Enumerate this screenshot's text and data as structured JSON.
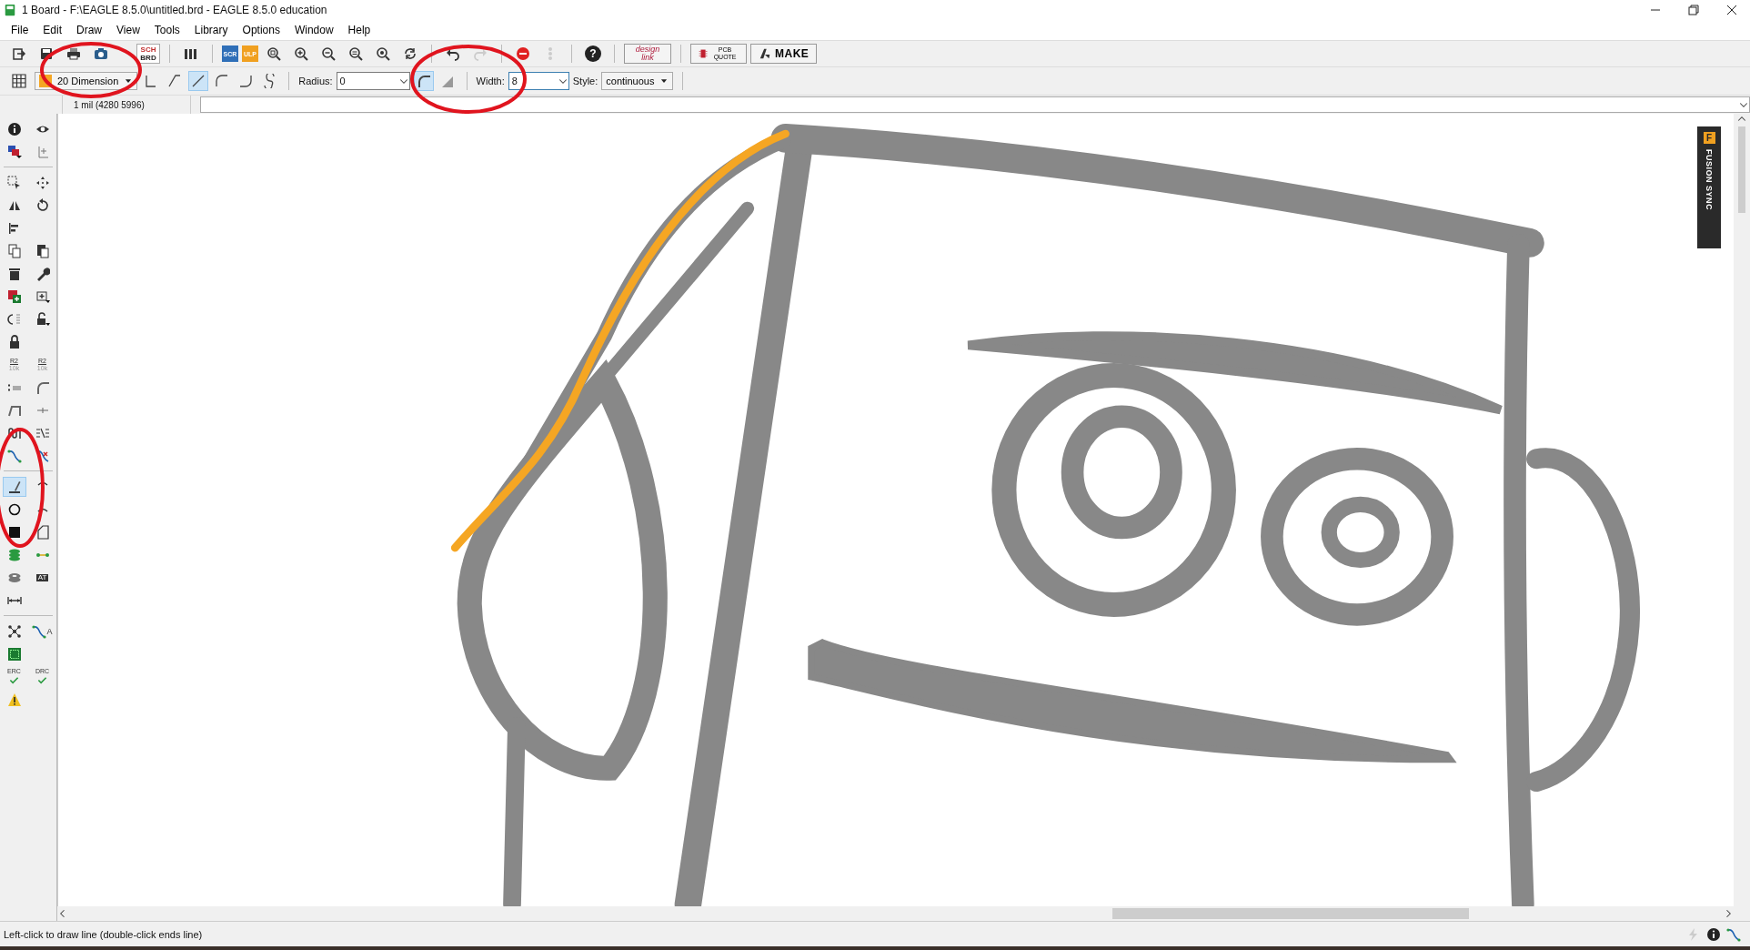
{
  "window": {
    "title": "1 Board - F:\\EAGLE 8.5.0\\untitled.brd - EAGLE 8.5.0 education"
  },
  "menu": [
    "File",
    "Edit",
    "Draw",
    "View",
    "Tools",
    "Library",
    "Options",
    "Window",
    "Help"
  ],
  "toolbar": {
    "switch_labels": [
      "SCH",
      "BRD"
    ],
    "script_label": "SCR",
    "ulp_label": "ULP",
    "design_link": "design link",
    "pcb_quote": "PCB QUOTE",
    "make": "MAKE",
    "help_label": "?"
  },
  "param_bar": {
    "layer": {
      "name": "20 Dimension",
      "color": "#f5a623"
    },
    "bend_styles": [
      {
        "selected": false
      },
      {
        "selected": false
      },
      {
        "selected": true
      },
      {
        "selected": false
      },
      {
        "selected": false
      },
      {
        "selected": false
      }
    ],
    "radius": {
      "label": "Radius:",
      "value": "0"
    },
    "miter_styles": [
      {
        "selected": true
      },
      {
        "selected": false
      }
    ],
    "width": {
      "label": "Width:",
      "value": "8"
    },
    "style": {
      "label": "Style:",
      "value": "continuous"
    }
  },
  "command_bar": {
    "coordinates": "1 mil (4280 5996)"
  },
  "left_toolbar": {
    "name_tool": [
      "R2",
      "10k"
    ],
    "value_tool": [
      "R2",
      "10k"
    ],
    "attribute_label": "AT",
    "route_label": "A",
    "erc": "ERC",
    "drc": "DRC",
    "line_tool": {
      "selected": true
    }
  },
  "fusion_sync": {
    "badge": "F",
    "label": "FUSION SYNC"
  },
  "status_bar": {
    "message": "Left-click to draw line (double-click ends line)"
  }
}
